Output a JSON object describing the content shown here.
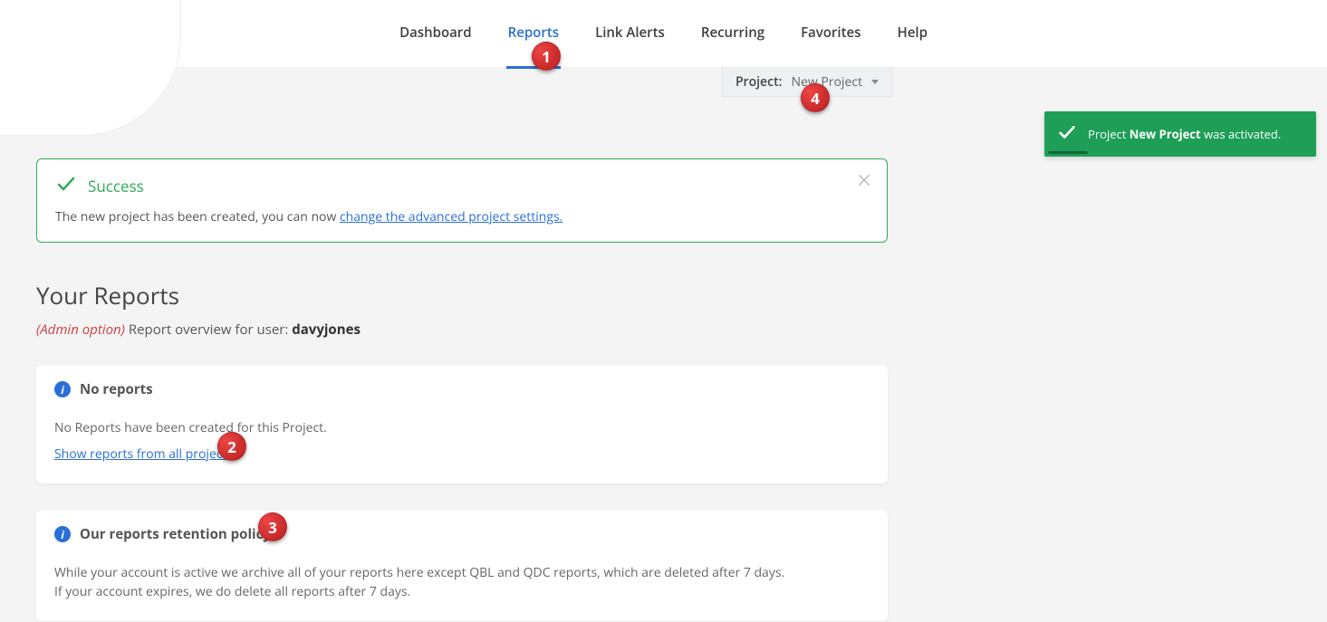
{
  "nav": {
    "items": [
      {
        "label": "Dashboard"
      },
      {
        "label": "Reports",
        "active": true
      },
      {
        "label": "Link Alerts"
      },
      {
        "label": "Recurring"
      },
      {
        "label": "Favorites"
      },
      {
        "label": "Help"
      }
    ]
  },
  "project_selector": {
    "label": "Project:",
    "value": "New Project"
  },
  "toast": {
    "prefix": "Project ",
    "name": "New Project",
    "suffix": " was activated."
  },
  "alert": {
    "title": "Success",
    "message": "The new project has been created, you can now ",
    "link_text": "change the advanced project settings."
  },
  "page": {
    "title": "Your Reports",
    "admin_label": "(Admin option)",
    "overview_text": " Report overview for user: ",
    "username": "davyjones"
  },
  "no_reports": {
    "title": "No reports",
    "body": "No Reports have been created for this Project.",
    "link": "Show reports from all projects"
  },
  "retention": {
    "title": "Our reports retention policy",
    "line1": "While your account is active we archive all of your reports here except QBL and QDC reports, which are deleted after 7 days.",
    "line2": "If your account expires, we do delete all reports after 7 days."
  },
  "markers": {
    "m1": "1",
    "m2": "2",
    "m3": "3",
    "m4": "4"
  }
}
